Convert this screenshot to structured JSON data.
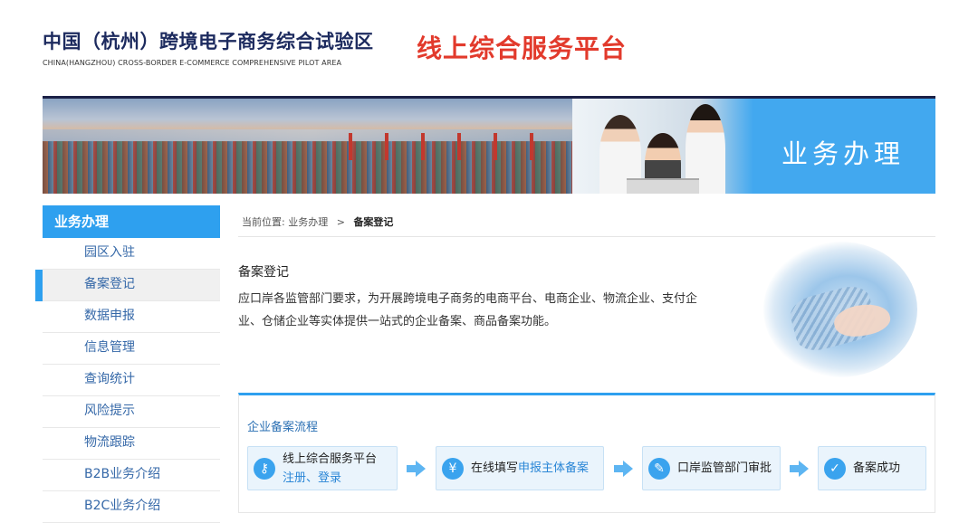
{
  "header": {
    "logo_cn": "中国（杭州）跨境电子商务综合试验区",
    "logo_en": "CHINA(HANGZHOU) CROSS-BORDER E-COMMERCE COMPREHENSIVE PILOT AREA",
    "platform_title": "线上综合服务平台"
  },
  "banner": {
    "text": "业务办理"
  },
  "sidebar": {
    "header": "业务办理",
    "items": [
      {
        "label": "园区入驻"
      },
      {
        "label": "备案登记",
        "active": true
      },
      {
        "label": "数据申报"
      },
      {
        "label": "信息管理"
      },
      {
        "label": "查询统计"
      },
      {
        "label": "风险提示"
      },
      {
        "label": "物流跟踪"
      },
      {
        "label": "B2B业务介绍"
      },
      {
        "label": "B2C业务介绍"
      }
    ]
  },
  "breadcrumb": {
    "prefix": "当前位置:",
    "parent": "业务办理",
    "separator": ">",
    "current": "备案登记"
  },
  "intro": {
    "title": "备案登记",
    "text": "应口岸各监管部门要求，为开展跨境电子商务的电商平台、电商企业、物流企业、支付企业、仓储企业等实体提供一站式的企业备案、商品备案功能。"
  },
  "flow": {
    "title": "企业备案流程",
    "steps": [
      {
        "line1": "线上综合服务平台",
        "link1": "注册",
        "sep": "、",
        "link2": "登录",
        "icon": "key-icon"
      },
      {
        "prefix": "在线填写",
        "highlight": "申报主体备案",
        "icon": "money-icon"
      },
      {
        "label": "口岸监管部门审批",
        "icon": "edit-icon"
      },
      {
        "label": "备案成功",
        "icon": "check-icon"
      }
    ]
  },
  "colors": {
    "accent": "#2ea0ef",
    "title_red": "#e23a2c",
    "link_blue": "#2a86d6"
  }
}
